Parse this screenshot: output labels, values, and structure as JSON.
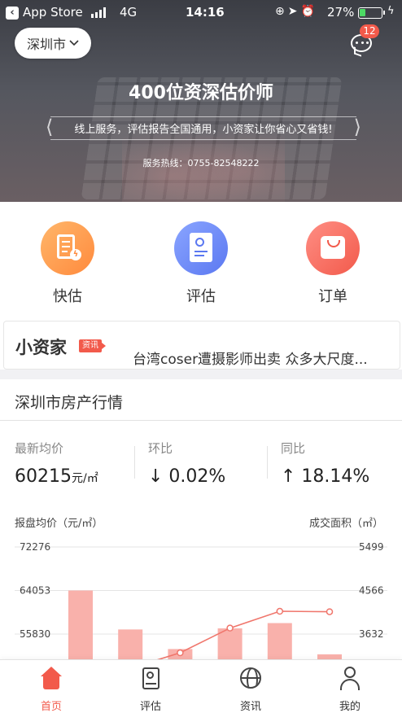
{
  "status_bar": {
    "back_app": "App Store",
    "network": "4G",
    "time": "14:16",
    "battery_percent": "27%",
    "battery_level": 0.27
  },
  "header": {
    "city": "深圳市",
    "message_badge": "12",
    "headline": "400位资深估价师",
    "banner": "线上服务，评估报告全国通用，小资家让你省心又省钱!",
    "hotline": "服务热线：0755-82548222"
  },
  "services": [
    {
      "label": "快估",
      "icon": "quick-estimate-icon",
      "color": "#ff8a3d"
    },
    {
      "label": "评估",
      "icon": "appraisal-icon",
      "color": "#5b78f1"
    },
    {
      "label": "订单",
      "icon": "order-bag-icon",
      "color": "#f25a4b"
    }
  ],
  "news": {
    "brand": "小资家",
    "tag": "资讯",
    "headline": "台湾coser遭摄影师出卖 众多大尺度..."
  },
  "market": {
    "title": "深圳市房产行情",
    "stats": [
      {
        "label": "最新均价",
        "value": "60215",
        "unit": "元/㎡"
      },
      {
        "label": "环比",
        "value": "↓ 0.02%"
      },
      {
        "label": "同比",
        "value": "↑ 18.14%"
      }
    ]
  },
  "chart_data": {
    "type": "bar",
    "ylabel": "报盘均价（元/㎡）",
    "y2label": "成交面积（㎡）",
    "y_ticks": [
      "72276",
      "64053",
      "55830"
    ],
    "y2_ticks": [
      "5499",
      "4566",
      "3632"
    ],
    "ylim_visible": [
      55830,
      72276
    ],
    "y2lim_visible": [
      3632,
      5499
    ],
    "bars": [
      {
        "value": 64053
      },
      {
        "value": 56700
      },
      {
        "value": 53000
      },
      {
        "value": 56900
      },
      {
        "value": 57900
      },
      {
        "value": 52000
      }
    ],
    "line": [
      {
        "value": 2700
      },
      {
        "value": 2900
      },
      {
        "value": 3230
      },
      {
        "value": 3760
      },
      {
        "value": 4120
      },
      {
        "value": 4110
      }
    ],
    "bar_color": "#f9b1ab",
    "line_color": "#f0766c"
  },
  "tabbar": [
    {
      "label": "首页",
      "active": true
    },
    {
      "label": "评估",
      "active": false
    },
    {
      "label": "资讯",
      "active": false
    },
    {
      "label": "我的",
      "active": false
    }
  ]
}
